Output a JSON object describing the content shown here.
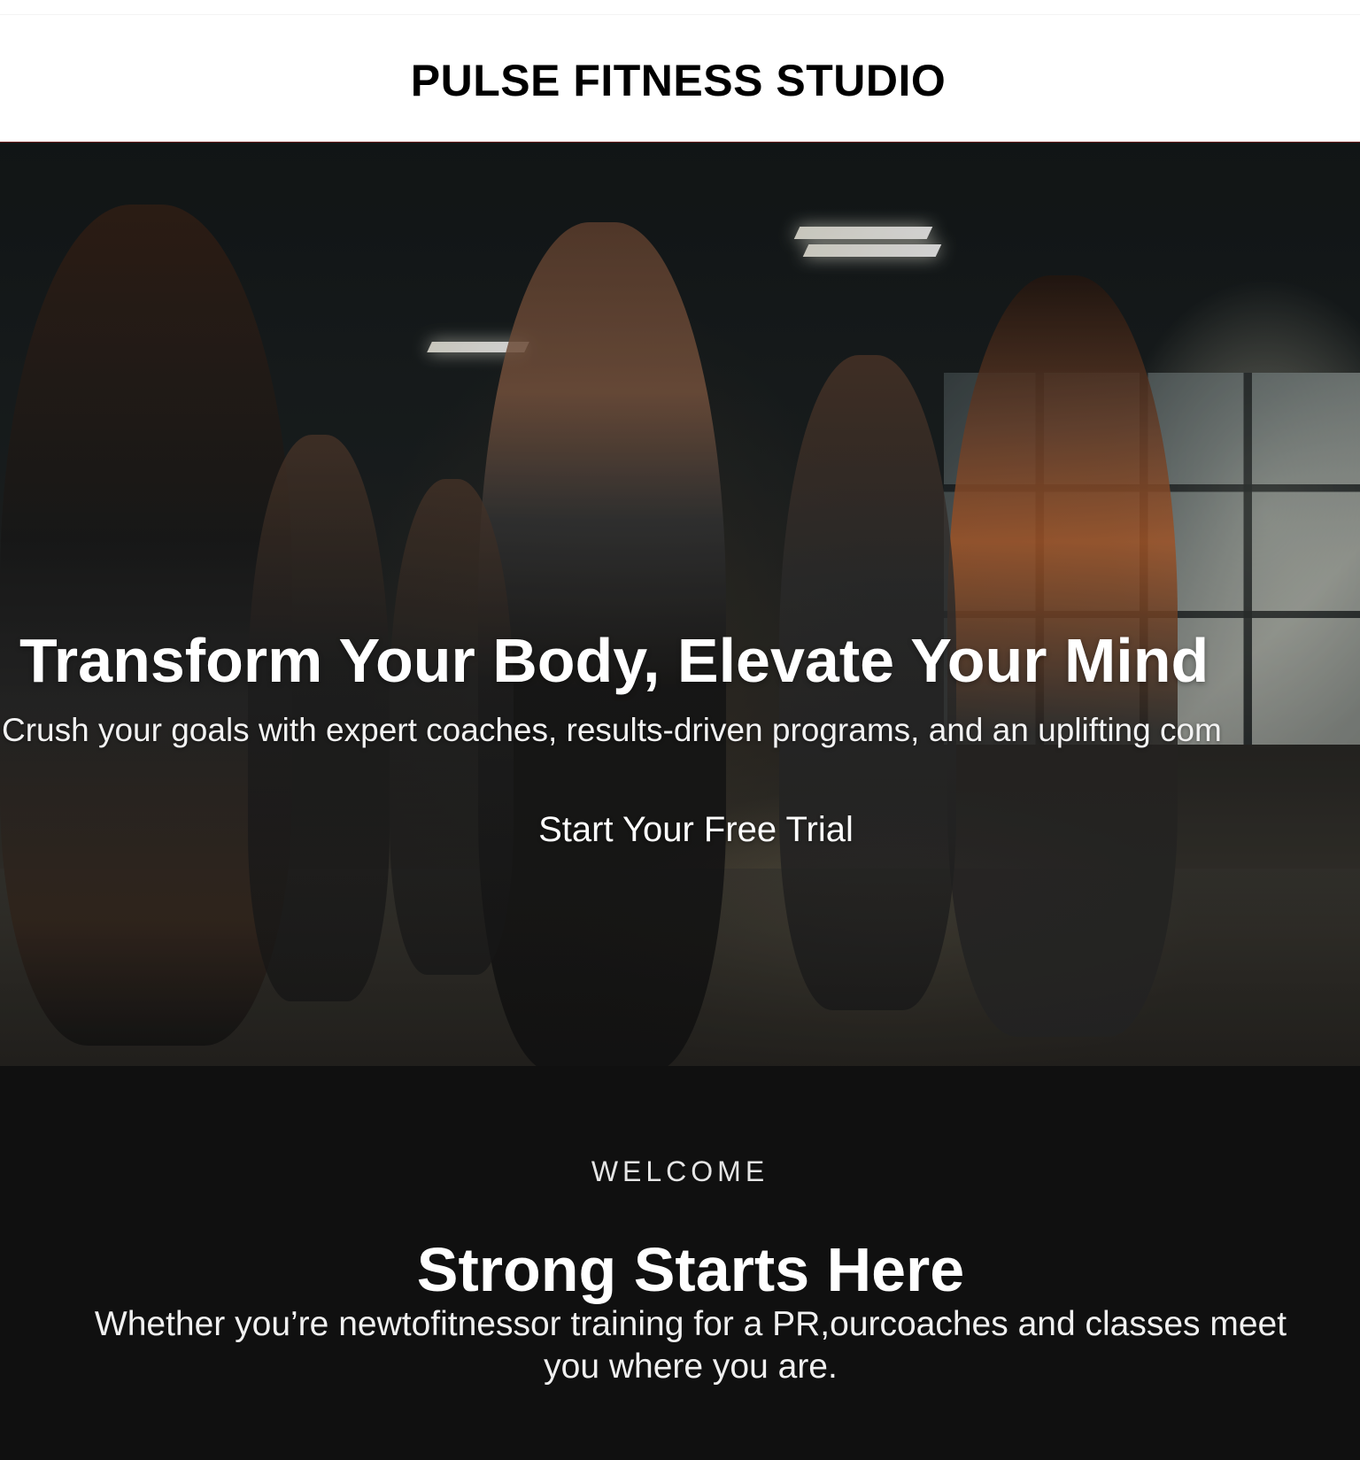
{
  "header": {
    "brand": "PULSE FITNESS STUDIO"
  },
  "hero": {
    "image_description_icon": "fitness-class-photo",
    "title": "Transform Your Body, Elevate Your Mind",
    "subtitle": "Crush your goals with expert coaches, results-driven programs, and an uplifting com",
    "cta_label": "Start Your Free Trial"
  },
  "welcome": {
    "kicker": "WELCOME",
    "title": "Strong Starts Here",
    "body": "Whether you’re newtofitnessor training for a PR,ourcoaches and classes meet you where you are."
  },
  "colors": {
    "header_bg": "#ffffff",
    "welcome_bg": "#101010",
    "text_light": "#ffffff"
  }
}
